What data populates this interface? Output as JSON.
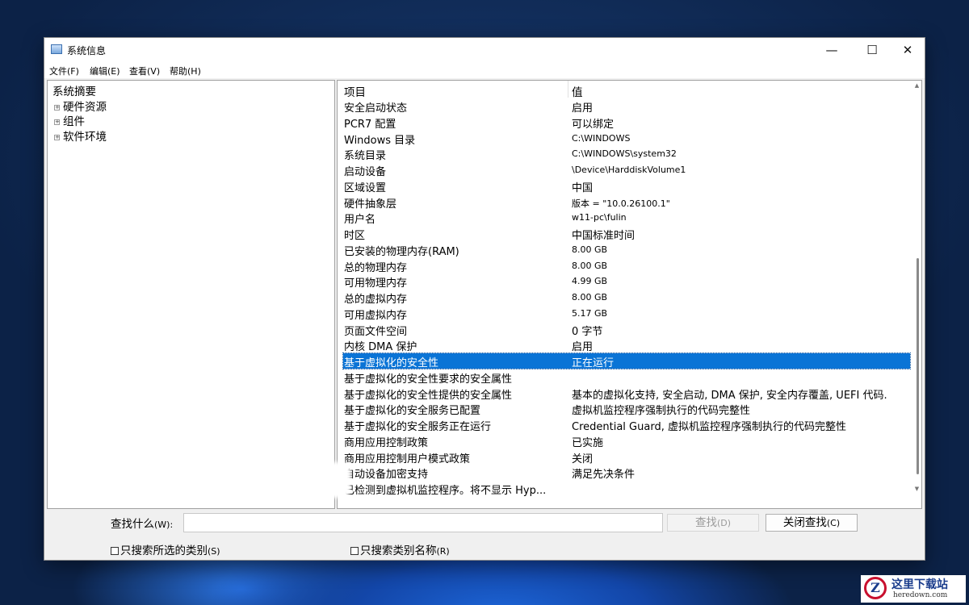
{
  "window": {
    "title": "系统信息"
  },
  "window_controls": {
    "minimize": "—",
    "maximize": "☐",
    "close": "✕"
  },
  "menu": [
    "文件(F)",
    "编辑(E)",
    "查看(V)",
    "帮助(H)"
  ],
  "tree": {
    "root": "系统摘要",
    "children": [
      "硬件资源",
      "组件",
      "软件环境"
    ]
  },
  "table": {
    "headers": [
      "项目",
      "值"
    ],
    "rows": [
      {
        "item": "安全启动状态",
        "value": "启用"
      },
      {
        "item": "PCR7 配置",
        "value": "可以绑定"
      },
      {
        "item": "Windows 目录",
        "value": "C:\\WINDOWS"
      },
      {
        "item": "系统目录",
        "value": "C:\\WINDOWS\\system32"
      },
      {
        "item": "启动设备",
        "value": "\\Device\\HarddiskVolume1"
      },
      {
        "item": "区域设置",
        "value": "中国"
      },
      {
        "item": "硬件抽象层",
        "value": "版本 = \"10.0.26100.1\""
      },
      {
        "item": "用户名",
        "value": "w11-pc\\fulin"
      },
      {
        "item": "时区",
        "value": "中国标准时间"
      },
      {
        "item": "已安装的物理内存(RAM)",
        "value": "8.00 GB"
      },
      {
        "item": "总的物理内存",
        "value": "8.00 GB"
      },
      {
        "item": "可用物理内存",
        "value": "4.99 GB"
      },
      {
        "item": "总的虚拟内存",
        "value": "8.00 GB"
      },
      {
        "item": "可用虚拟内存",
        "value": "5.17 GB"
      },
      {
        "item": "页面文件空间",
        "value": "0 字节"
      },
      {
        "item": "内核 DMA 保护",
        "value": "启用"
      },
      {
        "item": "基于虚拟化的安全性",
        "value": "正在运行"
      },
      {
        "item": "基于虚拟化的安全性要求的安全属性",
        "value": ""
      },
      {
        "item": "基于虚拟化的安全性提供的安全属性",
        "value": "基本的虚拟化支持, 安全启动, DMA 保护, 安全内存覆盖, UEFI 代码."
      },
      {
        "item": "基于虚拟化的安全服务已配置",
        "value": "虚拟机监控程序强制执行的代码完整性"
      },
      {
        "item": "基于虚拟化的安全服务正在运行",
        "value": "Credential Guard, 虚拟机监控程序强制执行的代码完整性"
      },
      {
        "item": "商用应用控制政策",
        "value": "已实施"
      },
      {
        "item": "商用应用控制用户模式政策",
        "value": "关闭"
      },
      {
        "item": "自动设备加密支持",
        "value": "满足先决条件"
      },
      {
        "item": "已检测到虚拟机监控程序。将不显示 Hyp...",
        "value": ""
      }
    ],
    "selected_row": 16
  },
  "search": {
    "label": "查找什么",
    "label_key": "(W):",
    "value": "",
    "find_button": "查找",
    "find_key": "(D)",
    "close_button": "关闭查找",
    "close_key": "(C)",
    "check_selected": "只搜索所选的类别",
    "check_selected_key": "(S)",
    "check_names": "只搜索类别名称",
    "check_names_key": "(R)"
  },
  "watermark": {
    "logo": "Z",
    "name": "这里下载站",
    "url": "heredown.com"
  },
  "colors": {
    "selection": "#0a74d6",
    "window_bg": "#f0f0f0"
  }
}
